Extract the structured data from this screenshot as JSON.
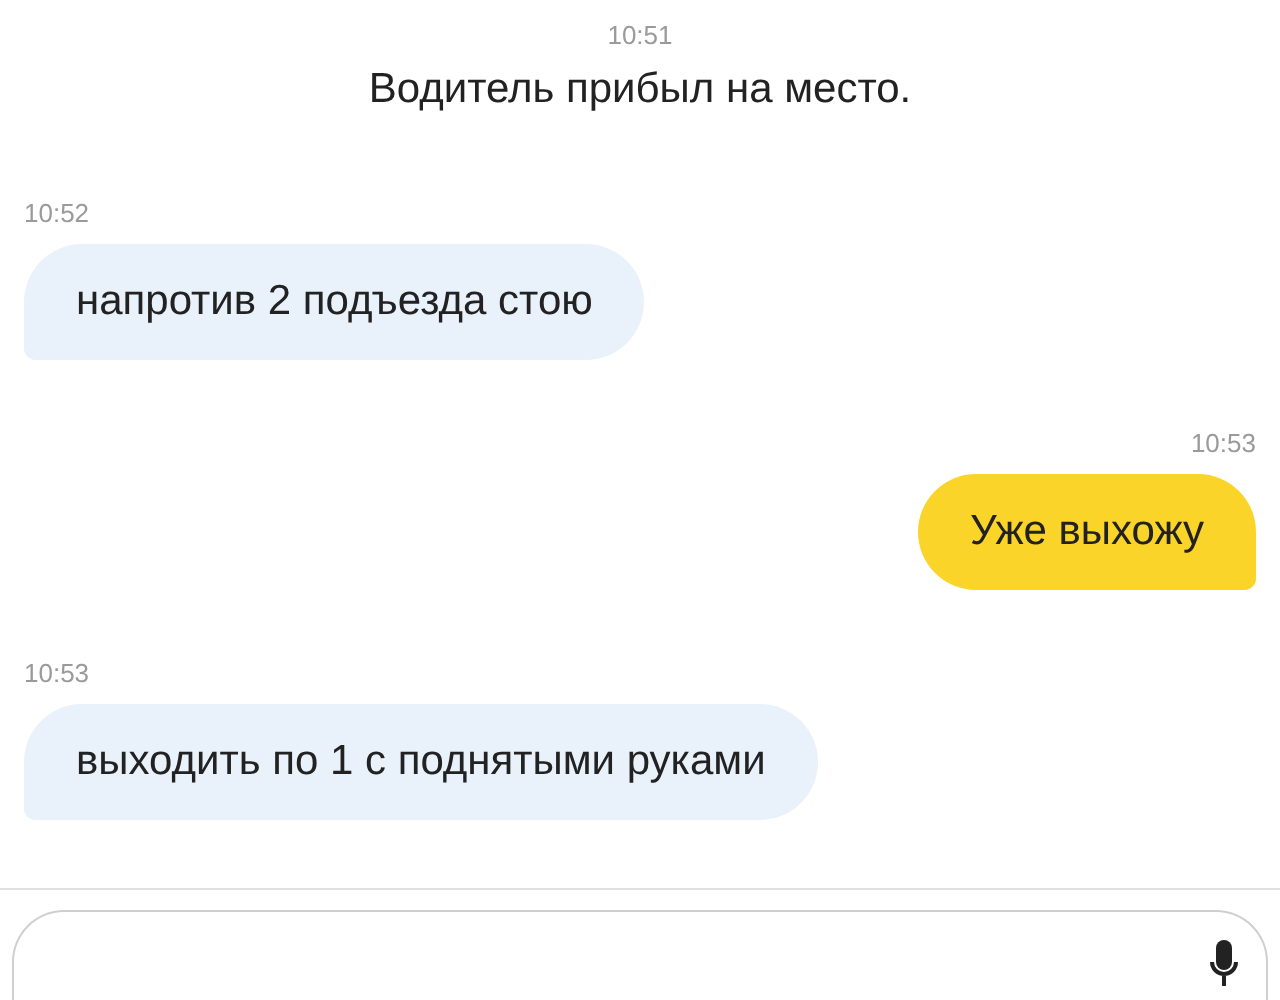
{
  "messages": [
    {
      "kind": "system",
      "time": "10:51",
      "text": "Водитель прибыл на место."
    },
    {
      "kind": "incoming",
      "time": "10:52",
      "text": "напротив 2 подъезда стою"
    },
    {
      "kind": "outgoing",
      "time": "10:53",
      "text": "Уже выхожу"
    },
    {
      "kind": "incoming",
      "time": "10:53",
      "text": "выходить по 1 с поднятыми руками"
    }
  ]
}
